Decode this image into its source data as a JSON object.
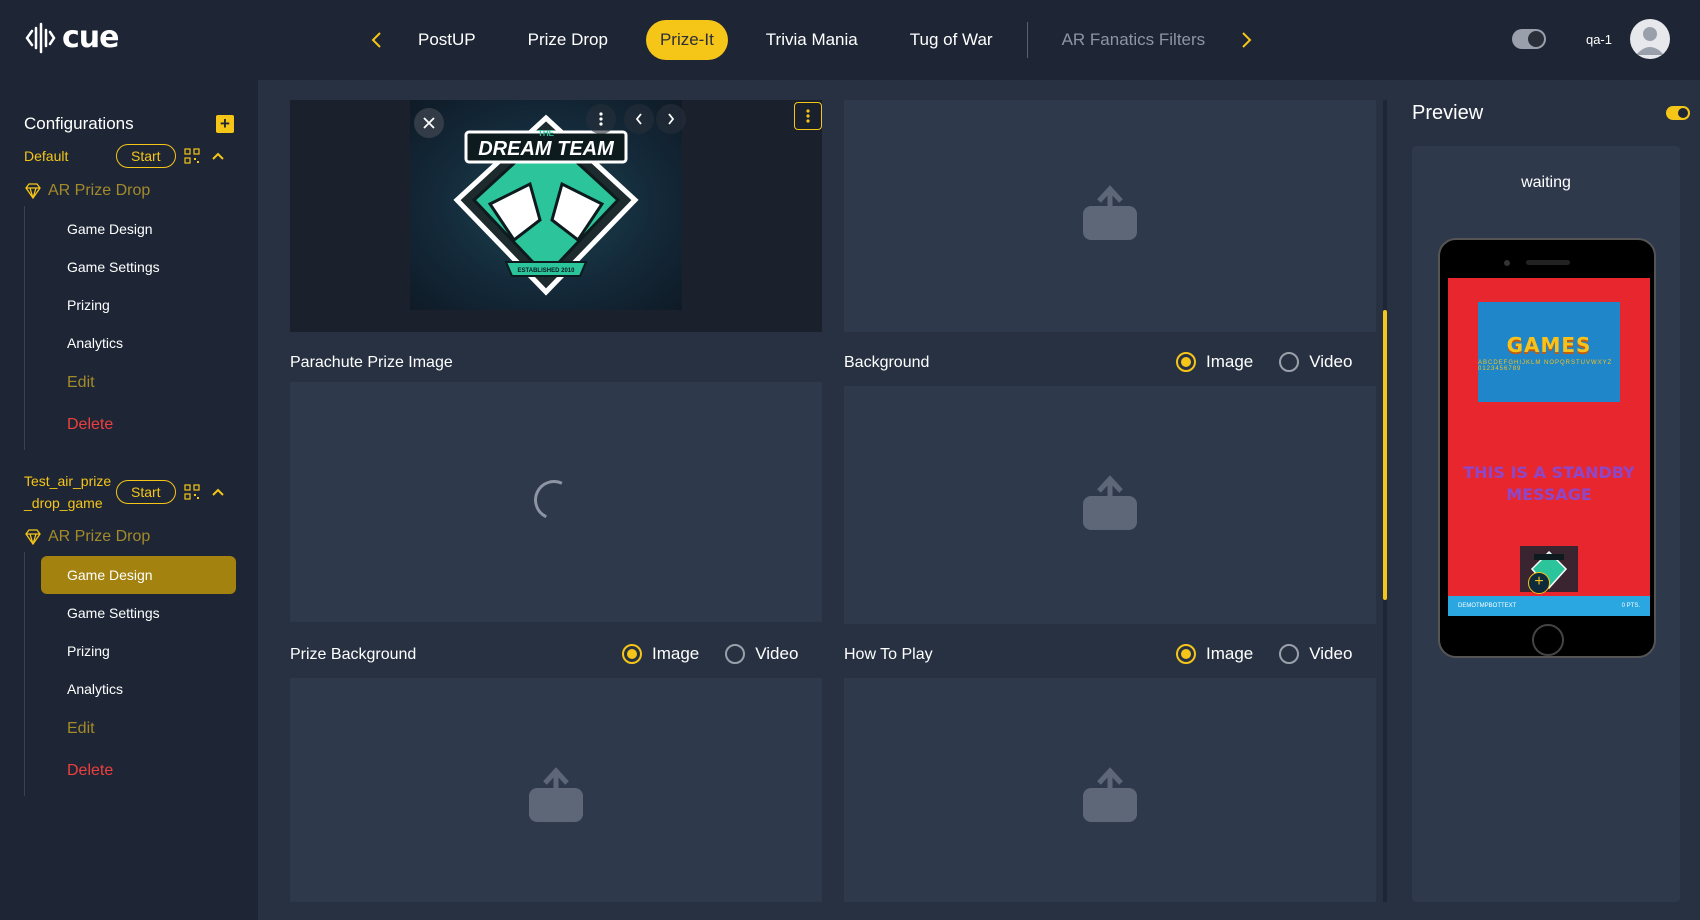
{
  "app": {
    "logo_text": "cue",
    "username": "qa-1"
  },
  "nav": {
    "tabs": [
      {
        "label": "PostUP"
      },
      {
        "label": "Prize Drop"
      },
      {
        "label": "Prize-It"
      },
      {
        "label": "Trivia Mania"
      },
      {
        "label": "Tug of War"
      },
      {
        "label": "AR Fanatics Filters"
      }
    ],
    "active_tab": "Prize-It"
  },
  "sidebar": {
    "title": "Configurations",
    "games": [
      {
        "name": "Default",
        "start_label": "Start",
        "product": "AR Prize Drop",
        "menu": [
          "Game Design",
          "Game Settings",
          "Prizing",
          "Analytics"
        ],
        "edit_label": "Edit",
        "delete_label": "Delete"
      },
      {
        "name": "Test_air_prize_drop_game",
        "start_label": "Start",
        "product": "AR Prize Drop",
        "menu": [
          "Game Design",
          "Game Settings",
          "Prizing",
          "Analytics"
        ],
        "active_item": "Game Design",
        "edit_label": "Edit",
        "delete_label": "Delete"
      }
    ]
  },
  "main": {
    "image_card": {
      "logo_small_text": "THE",
      "logo_text": "DREAM TEAM",
      "logo_ribbon": "ESTABLISHED 2010"
    },
    "sections": {
      "parachute": {
        "title": "Parachute Prize Image"
      },
      "background": {
        "title": "Background",
        "options": [
          "Image",
          "Video"
        ],
        "selected": "Image"
      },
      "prize_background": {
        "title": "Prize Background",
        "options": [
          "Image",
          "Video"
        ],
        "selected": "Image"
      },
      "how_to_play": {
        "title": "How To Play",
        "options": [
          "Image",
          "Video"
        ],
        "selected": "Image"
      }
    }
  },
  "preview": {
    "title": "Preview",
    "status": "waiting",
    "games_word": "GAMES",
    "games_sub": "ABCDEFGHIJKLM NOPQRSTUVWXYZ 0123456789",
    "standby_text": "THIS IS A STANDBY MESSAGE",
    "bar_left": "DEMOTMPBOTTEXT",
    "bar_right": "0 PTS.",
    "toggle_on": true
  },
  "colors": {
    "accent": "#f5c518",
    "danger": "#ef3e3e",
    "bg": "#1e2635",
    "panel": "#283142",
    "card": "#2f394c"
  }
}
